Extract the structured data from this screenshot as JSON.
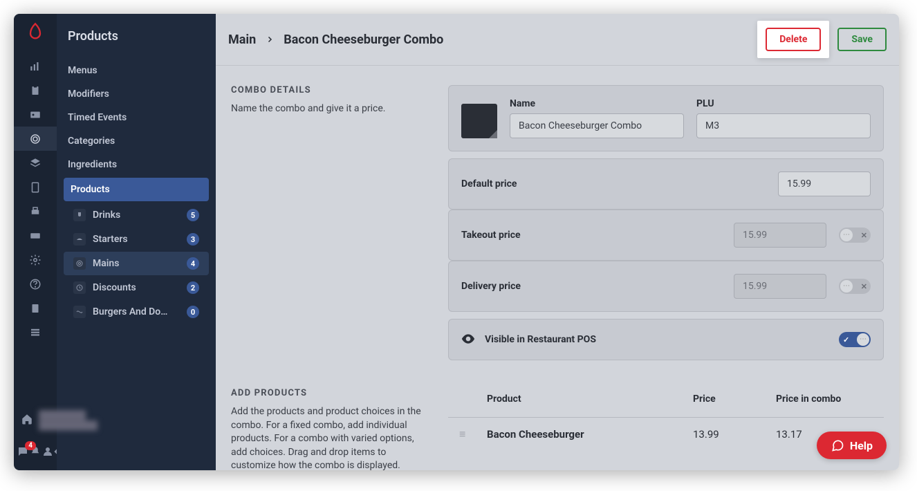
{
  "rail_icons": [
    "bars-icon",
    "clipboard-icon",
    "id-card-icon",
    "plate-icon",
    "layers-icon",
    "tablet-icon",
    "printer-icon",
    "card-icon",
    "gear-icon",
    "question-icon",
    "clipboard2-icon",
    "stack-icon"
  ],
  "rail_active_index": 3,
  "bottom_icons": [
    "chat-icon",
    "bell-icon",
    "user-icon",
    "logout-icon"
  ],
  "notification_count": "4",
  "sidebar": {
    "title": "Products",
    "items": [
      "Menus",
      "Modifiers",
      "Timed Events",
      "Categories",
      "Ingredients",
      "Products"
    ],
    "selected_index": 5,
    "sub_items": [
      {
        "label": "Drinks",
        "badge": "5"
      },
      {
        "label": "Starters",
        "badge": "3"
      },
      {
        "label": "Mains",
        "badge": "4"
      },
      {
        "label": "Discounts",
        "badge": "2"
      },
      {
        "label": "Burgers And Do…",
        "badge": "0"
      }
    ],
    "sub_active_index": 2
  },
  "breadcrumb": {
    "parent": "Main",
    "current": "Bacon Cheeseburger Combo"
  },
  "actions": {
    "delete": "Delete",
    "save": "Save"
  },
  "combo_details": {
    "section_title": "COMBO DETAILS",
    "section_desc": "Name the combo and give it a price.",
    "name_label": "Name",
    "name_value": "Bacon Cheeseburger Combo",
    "plu_label": "PLU",
    "plu_value": "M3",
    "prices": [
      {
        "label": "Default price",
        "value": "15.99",
        "toggle": null
      },
      {
        "label": "Takeout price",
        "value": "15.99",
        "toggle": false
      },
      {
        "label": "Delivery price",
        "value": "15.99",
        "toggle": false
      }
    ],
    "visible_label": "Visible in Restaurant POS",
    "visible_toggle": true
  },
  "add_products": {
    "section_title": "ADD PRODUCTS",
    "section_desc": "Add the products and product choices in the combo. For a fixed combo, add individual products. For a combo with varied options, add choices. Drag and drop items to customize how the combo is displayed.",
    "columns": {
      "product": "Product",
      "price": "Price",
      "price_combo": "Price in combo"
    },
    "rows": [
      {
        "product": "Bacon Cheeseburger",
        "price": "13.99",
        "price_combo": "13.17"
      }
    ]
  },
  "help": {
    "label": "Help"
  }
}
